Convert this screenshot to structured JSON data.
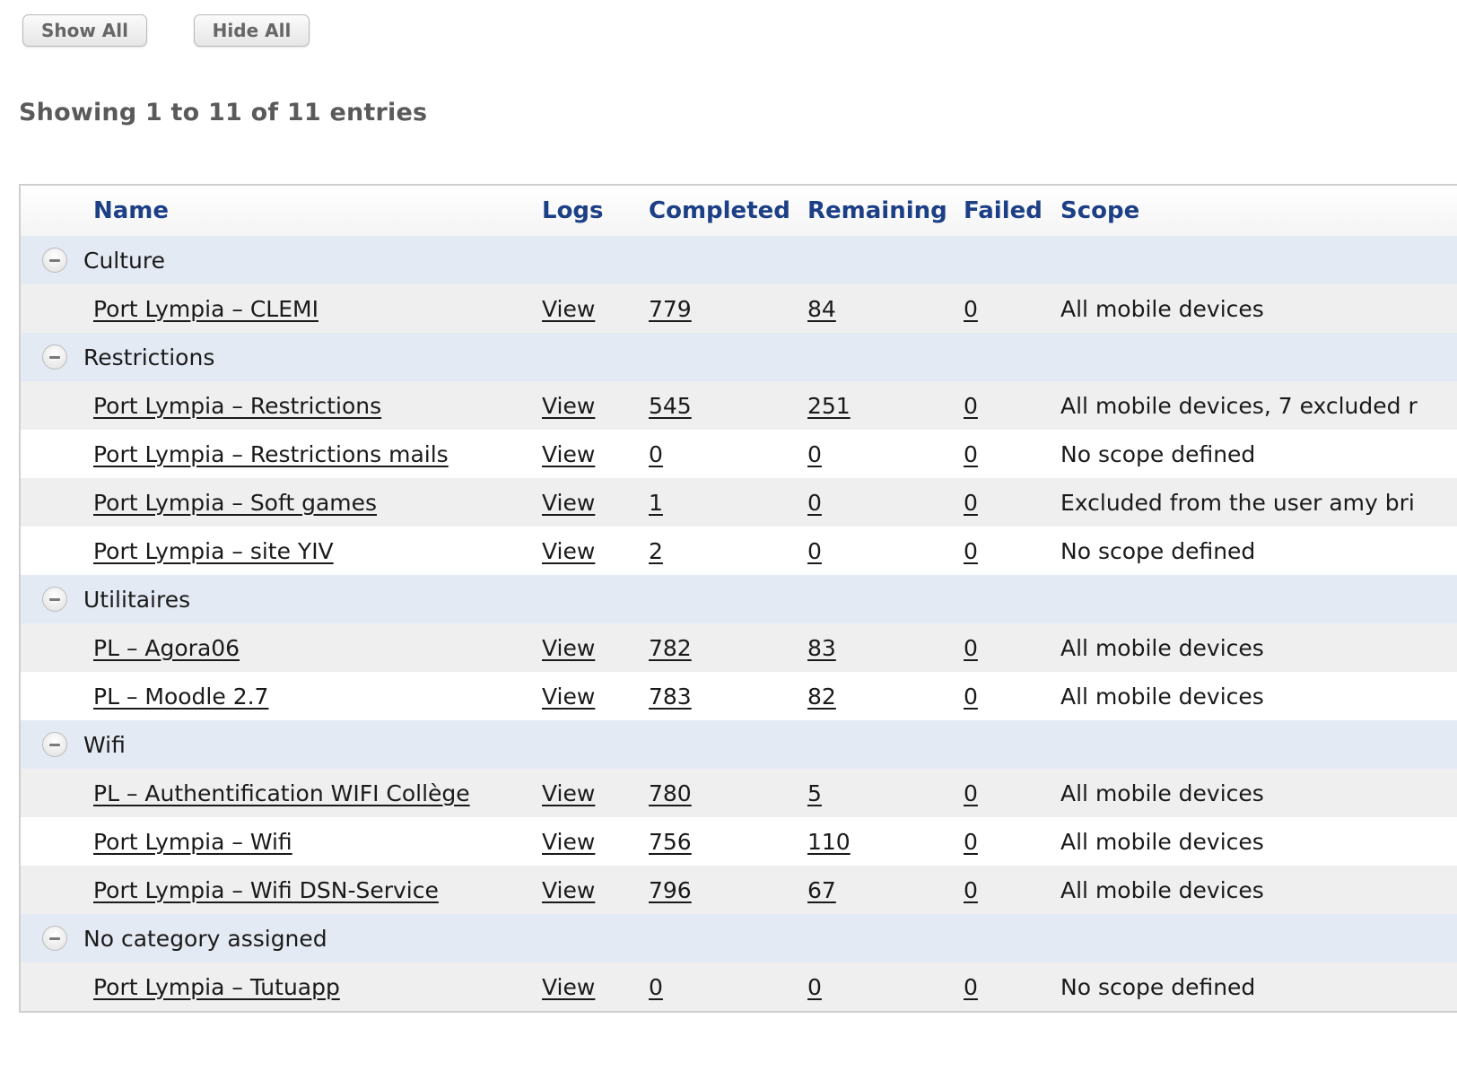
{
  "toolbar": {
    "show_all": "Show All",
    "hide_all": "Hide All"
  },
  "summary": "Showing 1 to 11 of 11 entries",
  "columns": {
    "name": "Name",
    "logs": "Logs",
    "completed": "Completed",
    "remaining": "Remaining",
    "failed": "Failed",
    "scope": "Scope"
  },
  "groups": [
    {
      "label": "Culture",
      "rows": [
        {
          "name": "Port Lympia – CLEMI",
          "logs": "View",
          "completed": "779",
          "remaining": "84",
          "failed": "0",
          "scope": "All mobile devices"
        }
      ]
    },
    {
      "label": "Restrictions",
      "rows": [
        {
          "name": "Port Lympia – Restrictions",
          "logs": "View",
          "completed": "545",
          "remaining": "251",
          "failed": "0",
          "scope": "All mobile devices, 7 excluded r"
        },
        {
          "name": "Port Lympia – Restrictions mails",
          "logs": "View",
          "completed": "0",
          "remaining": "0",
          "failed": "0",
          "scope": "No scope defined"
        },
        {
          "name": "Port Lympia – Soft games",
          "logs": "View",
          "completed": "1",
          "remaining": "0",
          "failed": "0",
          "scope": "Excluded from the user amy bri"
        },
        {
          "name": "Port Lympia – site YIV",
          "logs": "View",
          "completed": "2",
          "remaining": "0",
          "failed": "0",
          "scope": "No scope defined"
        }
      ]
    },
    {
      "label": "Utilitaires",
      "rows": [
        {
          "name": "PL – Agora06",
          "logs": "View",
          "completed": "782",
          "remaining": "83",
          "failed": "0",
          "scope": "All mobile devices"
        },
        {
          "name": "PL – Moodle 2.7",
          "logs": "View",
          "completed": "783",
          "remaining": "82",
          "failed": "0",
          "scope": "All mobile devices"
        }
      ]
    },
    {
      "label": "Wifi",
      "rows": [
        {
          "name": "PL – Authentification WIFI Collège",
          "logs": "View",
          "completed": "780",
          "remaining": "5",
          "failed": "0",
          "scope": "All mobile devices"
        },
        {
          "name": "Port Lympia – Wifi",
          "logs": "View",
          "completed": "756",
          "remaining": "110",
          "failed": "0",
          "scope": "All mobile devices"
        },
        {
          "name": "Port Lympia – Wifi DSN-Service",
          "logs": "View",
          "completed": "796",
          "remaining": "67",
          "failed": "0",
          "scope": "All mobile devices"
        }
      ]
    },
    {
      "label": "No category assigned",
      "rows": [
        {
          "name": "Port Lympia – Tutuapp",
          "logs": "View",
          "completed": "0",
          "remaining": "0",
          "failed": "0",
          "scope": "No scope defined"
        }
      ]
    }
  ]
}
